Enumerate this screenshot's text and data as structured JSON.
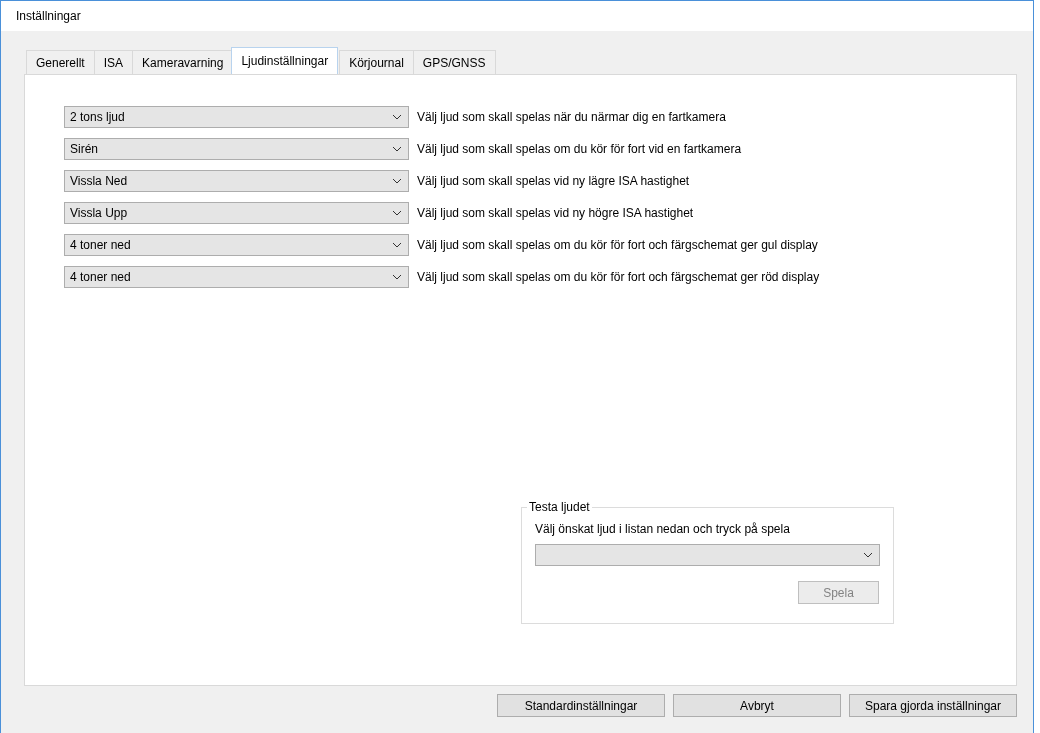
{
  "window": {
    "title": "Inställningar"
  },
  "tabs": [
    {
      "label": "Generellt",
      "selected": false
    },
    {
      "label": "ISA",
      "selected": false
    },
    {
      "label": "Kameravarning",
      "selected": false
    },
    {
      "label": "Ljudinställningar",
      "selected": true
    },
    {
      "label": "Körjournal",
      "selected": false
    },
    {
      "label": "GPS/GNSS",
      "selected": false
    }
  ],
  "sound_rows": [
    {
      "value": "2 tons ljud",
      "label": "Välj ljud som skall spelas när du närmar dig en fartkamera"
    },
    {
      "value": "Sirén",
      "label": "Välj ljud som skall spelas om du kör för fort vid en fartkamera"
    },
    {
      "value": "Vissla Ned",
      "label": "Välj ljud som skall spelas vid ny lägre ISA hastighet"
    },
    {
      "value": "Vissla Upp",
      "label": "Välj ljud som skall spelas vid ny högre ISA hastighet"
    },
    {
      "value": "4 toner ned",
      "label": "Välj ljud som skall spelas om du kör för fort och färgschemat ger gul display"
    },
    {
      "value": "4 toner ned",
      "label": "Välj ljud som skall spelas om du kör för fort och färgschemat ger röd display"
    }
  ],
  "test_group": {
    "title": "Testa ljudet",
    "instruction": "Välj önskat ljud i listan nedan och tryck på spela",
    "play_button": {
      "label": "Spela",
      "disabled": true
    }
  },
  "buttons": [
    {
      "label": "Standardinställningar"
    },
    {
      "label": "Avbryt"
    },
    {
      "label": "Spara gjorda inställningar"
    }
  ]
}
